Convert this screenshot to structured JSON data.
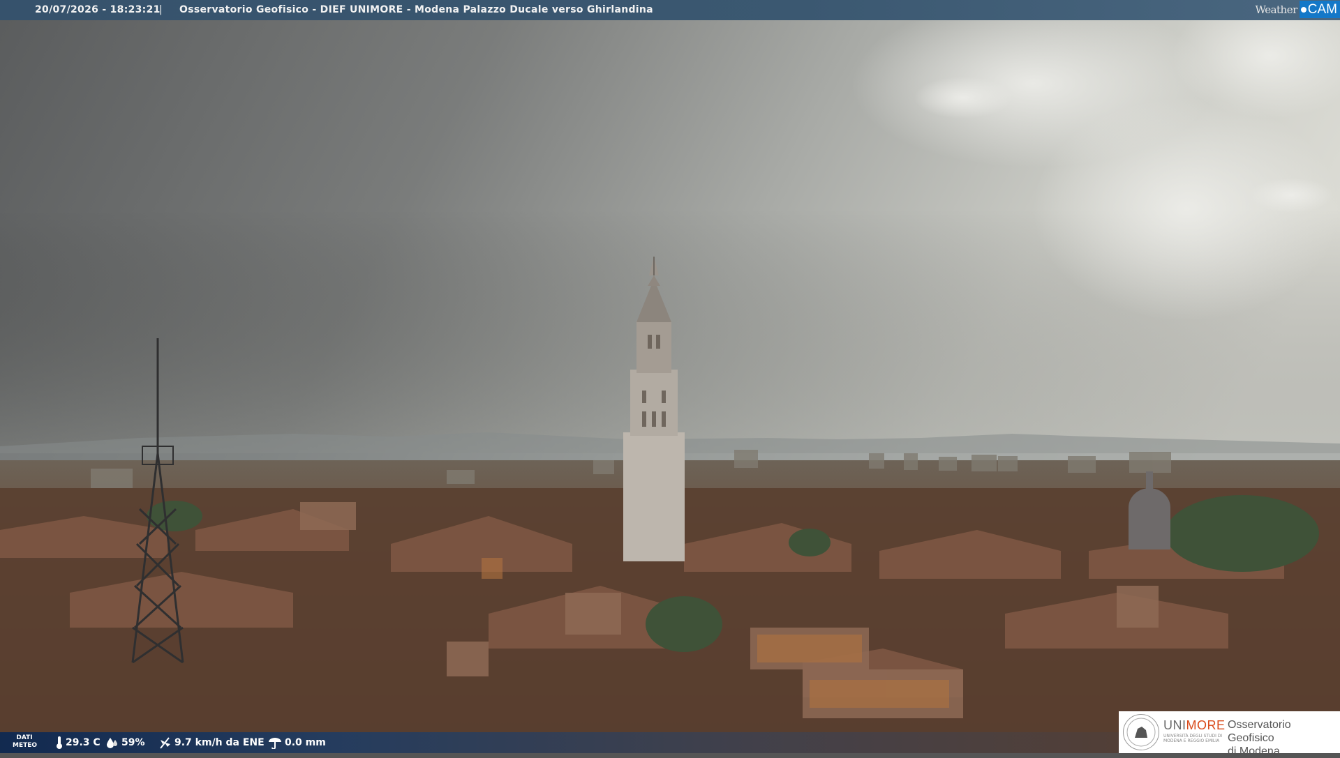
{
  "header": {
    "timestamp": "20/07/2026 - 18:23:21",
    "separator": "|",
    "title": "Osservatorio Geofisico - DIEF UNIMORE - Modena Palazzo Ducale verso Ghirlandina"
  },
  "brand": {
    "weather": "Weather",
    "cam": "CAM"
  },
  "weather_bar": {
    "label_line1": "DATI",
    "label_line2": "METEO",
    "temperature": "29.3 C",
    "humidity": "59%",
    "wind": "9.7 km/h da ENE",
    "rain": "0.0 mm",
    "icons": [
      "thermometer-icon",
      "humidity-drops-icon",
      "wind-vane-icon",
      "rain-gauge-icon"
    ]
  },
  "sponsor": {
    "uni_prefix": "UNI",
    "uni_suffix": "MORE",
    "uni_sub": "UNIVERSITÀ DEGLI STUDI DI MODENA E REGGIO EMILIA",
    "obs_line1": "Osservatorio Geofisico",
    "obs_line2": "di Modena",
    "accent": "#d94a1a"
  },
  "colors": {
    "sky_dark": "#5e6061",
    "sky_light": "#d9dad5",
    "roofs": "#6b5140",
    "bar": "#0c2852"
  }
}
